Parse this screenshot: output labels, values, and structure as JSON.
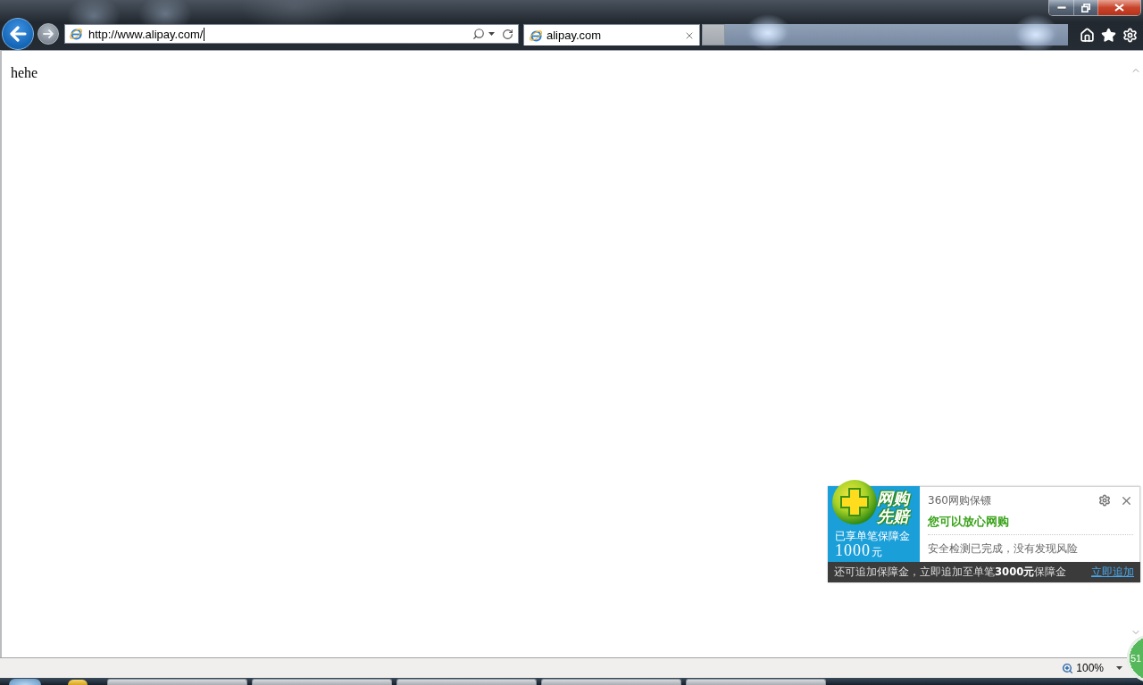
{
  "address_bar": {
    "value": "http://www.alipay.com/"
  },
  "tabs": [
    {
      "label": "alipay.com",
      "selected": true
    }
  ],
  "page": {
    "text": "hehe"
  },
  "popup": {
    "badge_title": "网购先赔",
    "badge_caption": "已享单笔保障金",
    "badge_amount": "1000",
    "badge_unit": "元",
    "title": "360网购保镖",
    "headline": "您可以放心网购",
    "message": "安全检测已完成，没有发现风险",
    "footer_text": "还可追加保障金，立即追加至单笔**3000元**保障金",
    "footer_link": "立即追加"
  },
  "floating_ball": {
    "label": "51"
  },
  "status_bar": {
    "zoom": "100%"
  }
}
